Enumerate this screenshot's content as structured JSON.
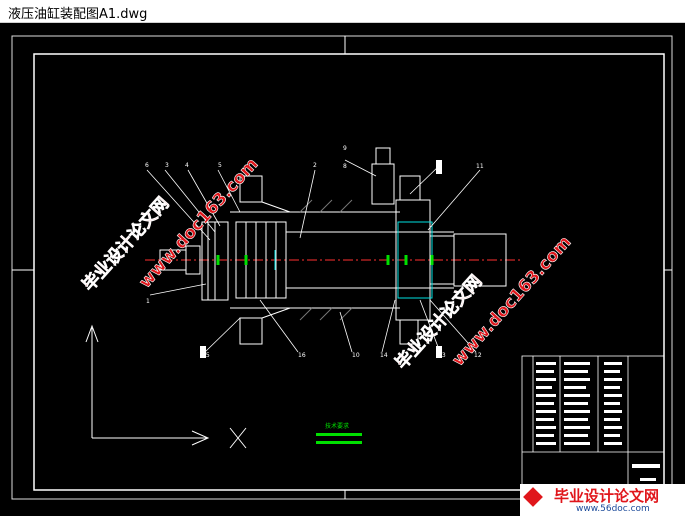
{
  "window": {
    "title": "液压油缸装配图A1.dwg"
  },
  "drawing": {
    "balloons": [
      "6",
      "3",
      "4",
      "5",
      "2",
      "9",
      "8",
      "11",
      "1",
      "16",
      "10",
      "14",
      "13",
      "12",
      "15"
    ],
    "axis_label": "X",
    "center_label": "技术要求"
  },
  "watermarks": {
    "site_cn": "毕业设计论文网",
    "site_url": "www.doc163.com",
    "footer_cn": "毕业设计论文网",
    "footer_url": "www.56doc.com"
  },
  "colors": {
    "background": "#000000",
    "line": "#ffffff",
    "cyan": "#00e0e0",
    "green": "#00e000",
    "red": "#ff3030",
    "watermark_red": "#e0161b"
  }
}
